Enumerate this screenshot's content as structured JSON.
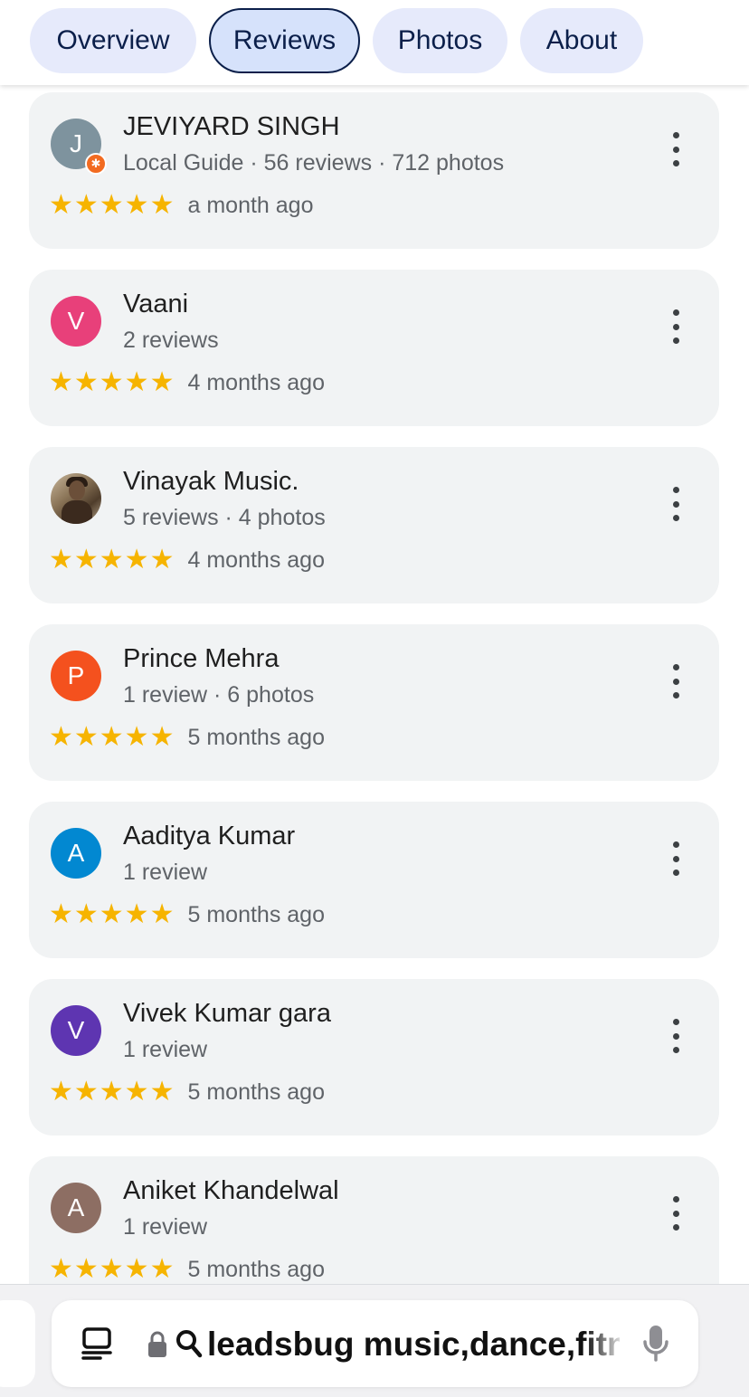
{
  "tabs": [
    {
      "label": "Overview",
      "active": false
    },
    {
      "label": "Reviews",
      "active": true
    },
    {
      "label": "Photos",
      "active": false
    },
    {
      "label": "About",
      "active": false
    }
  ],
  "reviews": [
    {
      "initial": "J",
      "name": "JEVIYARD SINGH",
      "meta": "Local Guide · 56 reviews · 712 photos",
      "stars": "★★★★★",
      "rating": 5,
      "time": "a month ago",
      "avatar_color": "#7e939e",
      "local_guide": true,
      "badge_icon": "star-burst-icon"
    },
    {
      "initial": "V",
      "name": "Vaani",
      "meta": "2 reviews",
      "stars": "★★★★★",
      "rating": 5,
      "time": "4 months ago",
      "avatar_color": "#e8407a"
    },
    {
      "initial": "",
      "name": "Vinayak Music.",
      "meta": "5 reviews · 4 photos",
      "stars": "★★★★★",
      "rating": 5,
      "time": "4 months ago",
      "avatar": "profile-photo"
    },
    {
      "initial": "P",
      "name": "Prince Mehra",
      "meta": "1 review · 6 photos",
      "stars": "★★★★★",
      "rating": 5,
      "time": "5 months ago",
      "avatar_color": "#f4511e"
    },
    {
      "initial": "A",
      "name": "Aaditya Kumar",
      "meta": "1 review",
      "stars": "★★★★★",
      "rating": 5,
      "time": "5 months ago",
      "avatar_color": "#0288d1"
    },
    {
      "initial": "V",
      "name": "Vivek Kumar gara",
      "meta": "1 review",
      "stars": "★★★★★",
      "rating": 5,
      "time": "5 months ago",
      "avatar_color": "#5e35b1"
    },
    {
      "initial": "A",
      "name": "Aniket Khandelwal",
      "meta": "1 review",
      "stars": "★★★★★",
      "rating": 5,
      "time": "5 months ago",
      "avatar_color": "#8d6e63"
    }
  ],
  "colors": {
    "star": "#f6b400",
    "accent": "#0b1f4a",
    "tab_bg": "#e6eafb"
  },
  "browser": {
    "address": "leadsbug music,dance,fitness",
    "icons": [
      "tabs-icon",
      "lock-icon",
      "search-icon",
      "microphone-icon"
    ]
  }
}
